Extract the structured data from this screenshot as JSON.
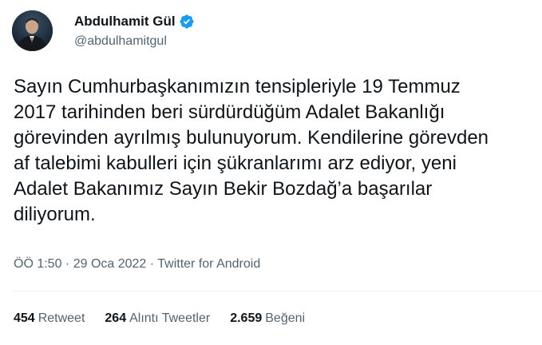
{
  "author": {
    "name": "Abdulhamit Gül",
    "handle": "@abdulhamitgul",
    "verified_color": "#1d9bf0"
  },
  "tweet": {
    "lines": [
      "Sayın Cumhurbaşkanımızın tensipleriyle 19 Temmuz",
      "2017 tarihinden beri sürdürdüğüm Adalet Bakanlığı",
      "görevinden ayrılmış bulunuyorum. Kendilerine görevden",
      "af talebimi kabulleri için şükranlarımı arz ediyor, yeni",
      "Adalet Bakanımız Sayın Bekir Bozdağ’a başarılar",
      "diliyorum."
    ]
  },
  "meta": {
    "time": "ÖÖ 1:50",
    "separator": " · ",
    "date": "29 Oca 2022",
    "source": "Twitter for Android"
  },
  "stats": {
    "retweets_count": "454",
    "retweets_label": "Retweet",
    "quotes_count": "264",
    "quotes_label": "Alıntı Tweetler",
    "likes_count": "2.659",
    "likes_label": "Beğeni"
  },
  "icons": {
    "avatar": "avatar-photo",
    "verified": "verified-badge-icon"
  }
}
